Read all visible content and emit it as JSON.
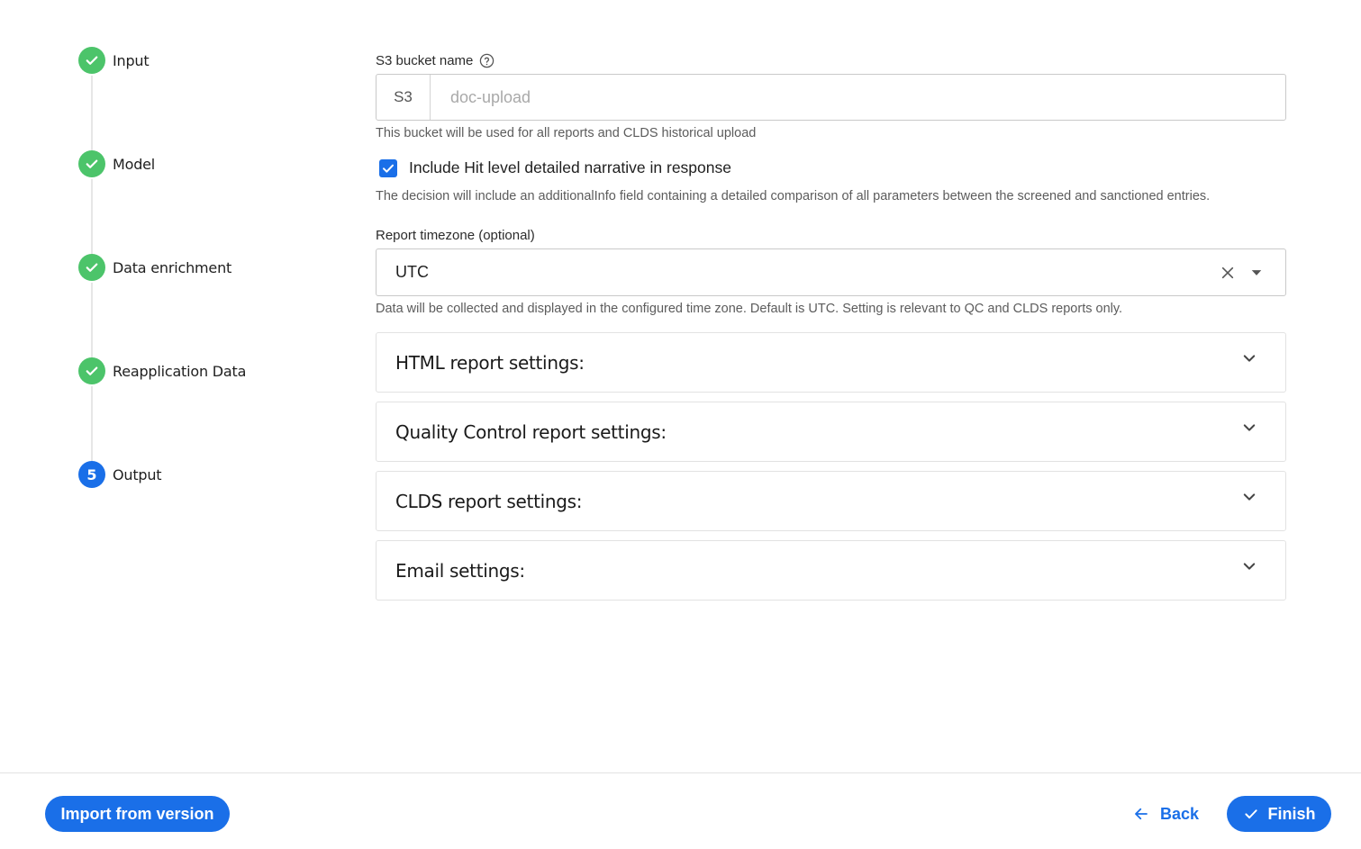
{
  "stepper": {
    "steps": [
      {
        "label": "Input",
        "status": "done",
        "icon": "check-icon"
      },
      {
        "label": "Model",
        "status": "done",
        "icon": "check-icon"
      },
      {
        "label": "Data enrichment",
        "status": "done",
        "icon": "check-icon"
      },
      {
        "label": "Reapplication Data",
        "status": "done",
        "icon": "check-icon"
      },
      {
        "label": "Output",
        "status": "active",
        "number": "5"
      }
    ],
    "done_color": "#4cc46a",
    "active_color": "#1a6fe8"
  },
  "s3": {
    "label": "S3 bucket name",
    "help_icon": "help-circle-icon",
    "prefix": "S3",
    "placeholder": "doc-upload",
    "value": "",
    "hint": "This bucket will be used for all reports and CLDS historical upload"
  },
  "narrative": {
    "checked": true,
    "label": "Include Hit level detailed narrative in response",
    "hint": "The decision will include an additionalInfo field containing a detailed comparison of all parameters between the screened and sanctioned entries."
  },
  "timezone": {
    "label": "Report timezone (optional)",
    "value": "UTC",
    "clear_icon": "close-icon",
    "arrow_icon": "dropdown-arrow-icon",
    "hint": "Data will be collected and displayed in the configured time zone. Default is UTC. Setting is relevant to QC and CLDS reports only."
  },
  "sections": [
    {
      "title": "HTML report settings:"
    },
    {
      "title": "Quality Control report settings:"
    },
    {
      "title": "CLDS report settings:"
    },
    {
      "title": "Email settings:"
    }
  ],
  "footer": {
    "import_label": "Import from version",
    "back_label": "Back",
    "finish_label": "Finish"
  },
  "colors": {
    "primary": "#1a6fe8",
    "success": "#4cc46a",
    "border": "#c9c9c9"
  }
}
